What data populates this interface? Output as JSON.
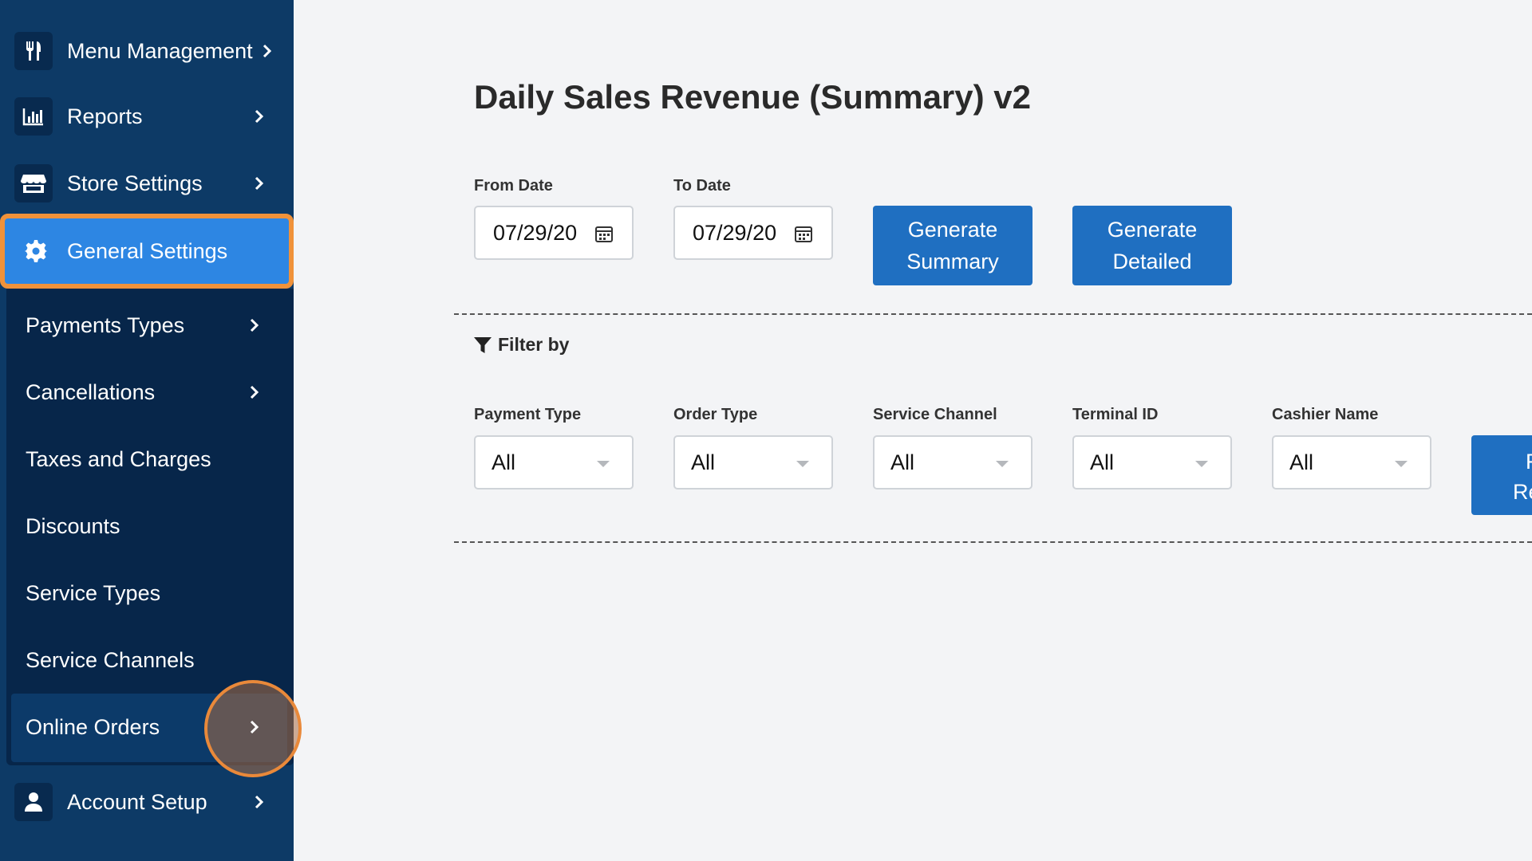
{
  "sidebar": {
    "top_items": [
      {
        "label": "Menu Management",
        "icon": "utensils-icon"
      },
      {
        "label": "Reports",
        "icon": "bar-chart-icon"
      },
      {
        "label": "Store Settings",
        "icon": "store-icon"
      }
    ],
    "active_item": {
      "label": "General Settings",
      "icon": "gear-icon"
    },
    "sub_items": [
      {
        "label": "Payments Types",
        "has_chevron": true
      },
      {
        "label": "Cancellations",
        "has_chevron": true
      },
      {
        "label": "Taxes and Charges",
        "has_chevron": false
      },
      {
        "label": "Discounts",
        "has_chevron": false
      },
      {
        "label": "Service Types",
        "has_chevron": false
      },
      {
        "label": "Service Channels",
        "has_chevron": false
      },
      {
        "label": "Online Orders",
        "has_chevron": true
      }
    ],
    "bottom_item": {
      "label": "Account Setup",
      "icon": "user-icon"
    }
  },
  "main": {
    "title": "Daily Sales Revenue (Summary) v2",
    "from_date": {
      "label": "From Date",
      "value": "07/29/20"
    },
    "to_date": {
      "label": "To Date",
      "value": "07/29/20"
    },
    "generate_summary_label": "Generate\nSummary",
    "generate_detailed_label": "Generate\nDetailed",
    "filter_heading": "Filter by",
    "filters": [
      {
        "label": "Payment Type",
        "value": "All"
      },
      {
        "label": "Order Type",
        "value": "All"
      },
      {
        "label": "Service Channel",
        "value": "All"
      },
      {
        "label": "Terminal ID",
        "value": "All"
      },
      {
        "label": "Cashier Name",
        "value": "All"
      }
    ],
    "partial_button": {
      "line1": "F",
      "line2": "Re"
    }
  },
  "colors": {
    "sidebar_bg": "#0d3a66",
    "sub_panel_bg": "#07264a",
    "active_item_bg": "#2d86e3",
    "active_outline": "#f0923a",
    "primary_button": "#1f6fc1",
    "page_bg": "#f3f4f6"
  }
}
